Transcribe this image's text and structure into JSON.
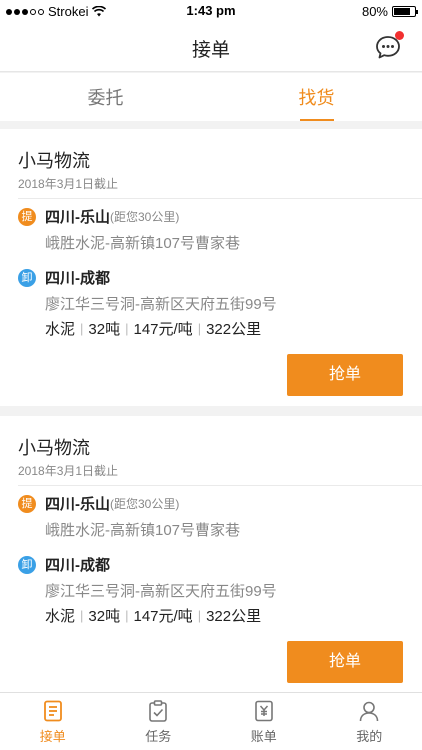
{
  "status_bar": {
    "carrier": "Strokei",
    "time": "1:43 pm",
    "battery": "80%",
    "battery_level": 0.8
  },
  "nav": {
    "title": "接单",
    "message_icon": "chat-bubble-icon"
  },
  "tabs": [
    {
      "label": "委托",
      "active": false
    },
    {
      "label": "找货",
      "active": true
    }
  ],
  "orders": [
    {
      "company": "小马物流",
      "deadline": "2018年3月1日截止",
      "pickup": {
        "badge": "提",
        "route": "四川-乐山",
        "distance": "(距您30公里)",
        "address": "峨胜水泥-高新镇107号曹家巷"
      },
      "unload": {
        "badge": "卸",
        "route": "四川-成都",
        "address": "廖江华三号洞-高新区天府五街99号"
      },
      "cargo": {
        "goods": "水泥",
        "weight": "32吨",
        "price": "147元/吨",
        "distance": "322公里",
        "separator": "|"
      },
      "button": "抢单"
    },
    {
      "company": "小马物流",
      "deadline": "2018年3月1日截止",
      "pickup": {
        "badge": "提",
        "route": "四川-乐山",
        "distance": "(距您30公里)",
        "address": "峨胜水泥-高新镇107号曹家巷"
      },
      "unload": {
        "badge": "卸",
        "route": "四川-成都",
        "address": "廖江华三号洞-高新区天府五街99号"
      },
      "cargo": {
        "goods": "水泥",
        "weight": "32吨",
        "price": "147元/吨",
        "distance": "322公里",
        "separator": "|"
      },
      "button": "抢单"
    }
  ],
  "tabbar": [
    {
      "label": "接单",
      "icon": "order-icon",
      "active": true
    },
    {
      "label": "任务",
      "icon": "task-icon",
      "active": false
    },
    {
      "label": "账单",
      "icon": "bill-icon",
      "active": false
    },
    {
      "label": "我的",
      "icon": "profile-icon",
      "active": false
    }
  ],
  "colors": {
    "accent": "#f08c1e",
    "unload_badge": "#3aa0e6",
    "notification_dot": "#f23030"
  }
}
